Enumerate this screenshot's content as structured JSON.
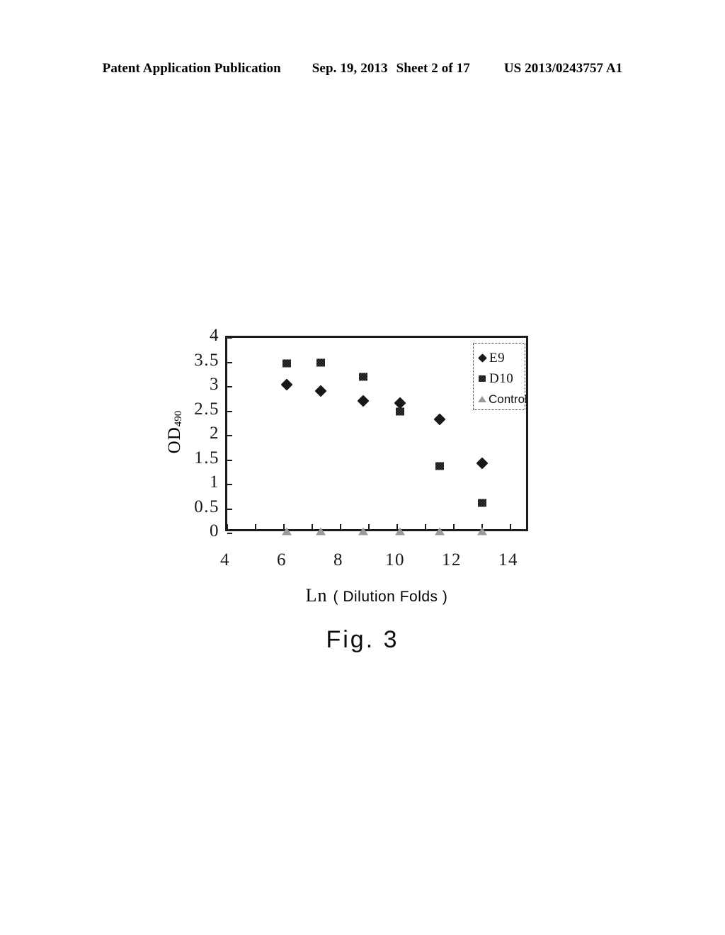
{
  "header": {
    "publication": "Patent Application Publication",
    "date": "Sep. 19, 2013",
    "sheet": "Sheet 2 of 17",
    "patent_number": "US 2013/0243757 A1"
  },
  "figure": {
    "caption": "Fig. 3"
  },
  "axis": {
    "y_title_main": "OD",
    "y_title_sub": "490",
    "x_title_main": "Ln",
    "x_title_paren": "( Dilution Folds )"
  },
  "legend": {
    "entries": [
      {
        "label": "E9",
        "marker": "diamond",
        "color": "#181818"
      },
      {
        "label": "D10",
        "marker": "square",
        "color": "#3a3a3a"
      },
      {
        "label": "Control",
        "marker": "triangle",
        "color": "#9a9a9a"
      }
    ]
  },
  "chart_data": {
    "type": "scatter",
    "title": "Fig. 3",
    "xlabel": "Ln ( Dilution Folds )",
    "ylabel": "OD490",
    "xlim": [
      4,
      14.7
    ],
    "ylim": [
      0,
      4
    ],
    "xticks": [
      4,
      6,
      8,
      10,
      12,
      14
    ],
    "yticks": [
      0,
      0.5,
      1,
      1.5,
      2,
      2.5,
      3,
      3.5,
      4
    ],
    "xtick_labels": [
      "4",
      "6",
      "8",
      "10",
      "12",
      "14"
    ],
    "ytick_labels": [
      "0",
      "0.5",
      "1",
      "1.5",
      "2",
      "2.5",
      "3",
      "3.5",
      "4"
    ],
    "grid": false,
    "legend_position": "top-right",
    "series": [
      {
        "name": "E9",
        "marker": "diamond",
        "color": "#181818",
        "x": [
          6.1,
          7.3,
          8.8,
          10.1,
          11.5,
          13.0
        ],
        "y": [
          3.05,
          2.92,
          2.71,
          2.67,
          2.33,
          1.44
        ]
      },
      {
        "name": "D10",
        "marker": "square",
        "color": "#3a3a3a",
        "x": [
          6.1,
          7.3,
          8.8,
          10.1,
          11.5,
          13.0
        ],
        "y": [
          3.48,
          3.49,
          3.21,
          2.5,
          1.37,
          0.62
        ]
      },
      {
        "name": "Control",
        "marker": "triangle",
        "color": "#9a9a9a",
        "x": [
          6.1,
          7.3,
          8.8,
          10.1,
          11.5,
          13.0
        ],
        "y": [
          0.04,
          0.04,
          0.04,
          0.04,
          0.04,
          0.04
        ]
      }
    ]
  }
}
